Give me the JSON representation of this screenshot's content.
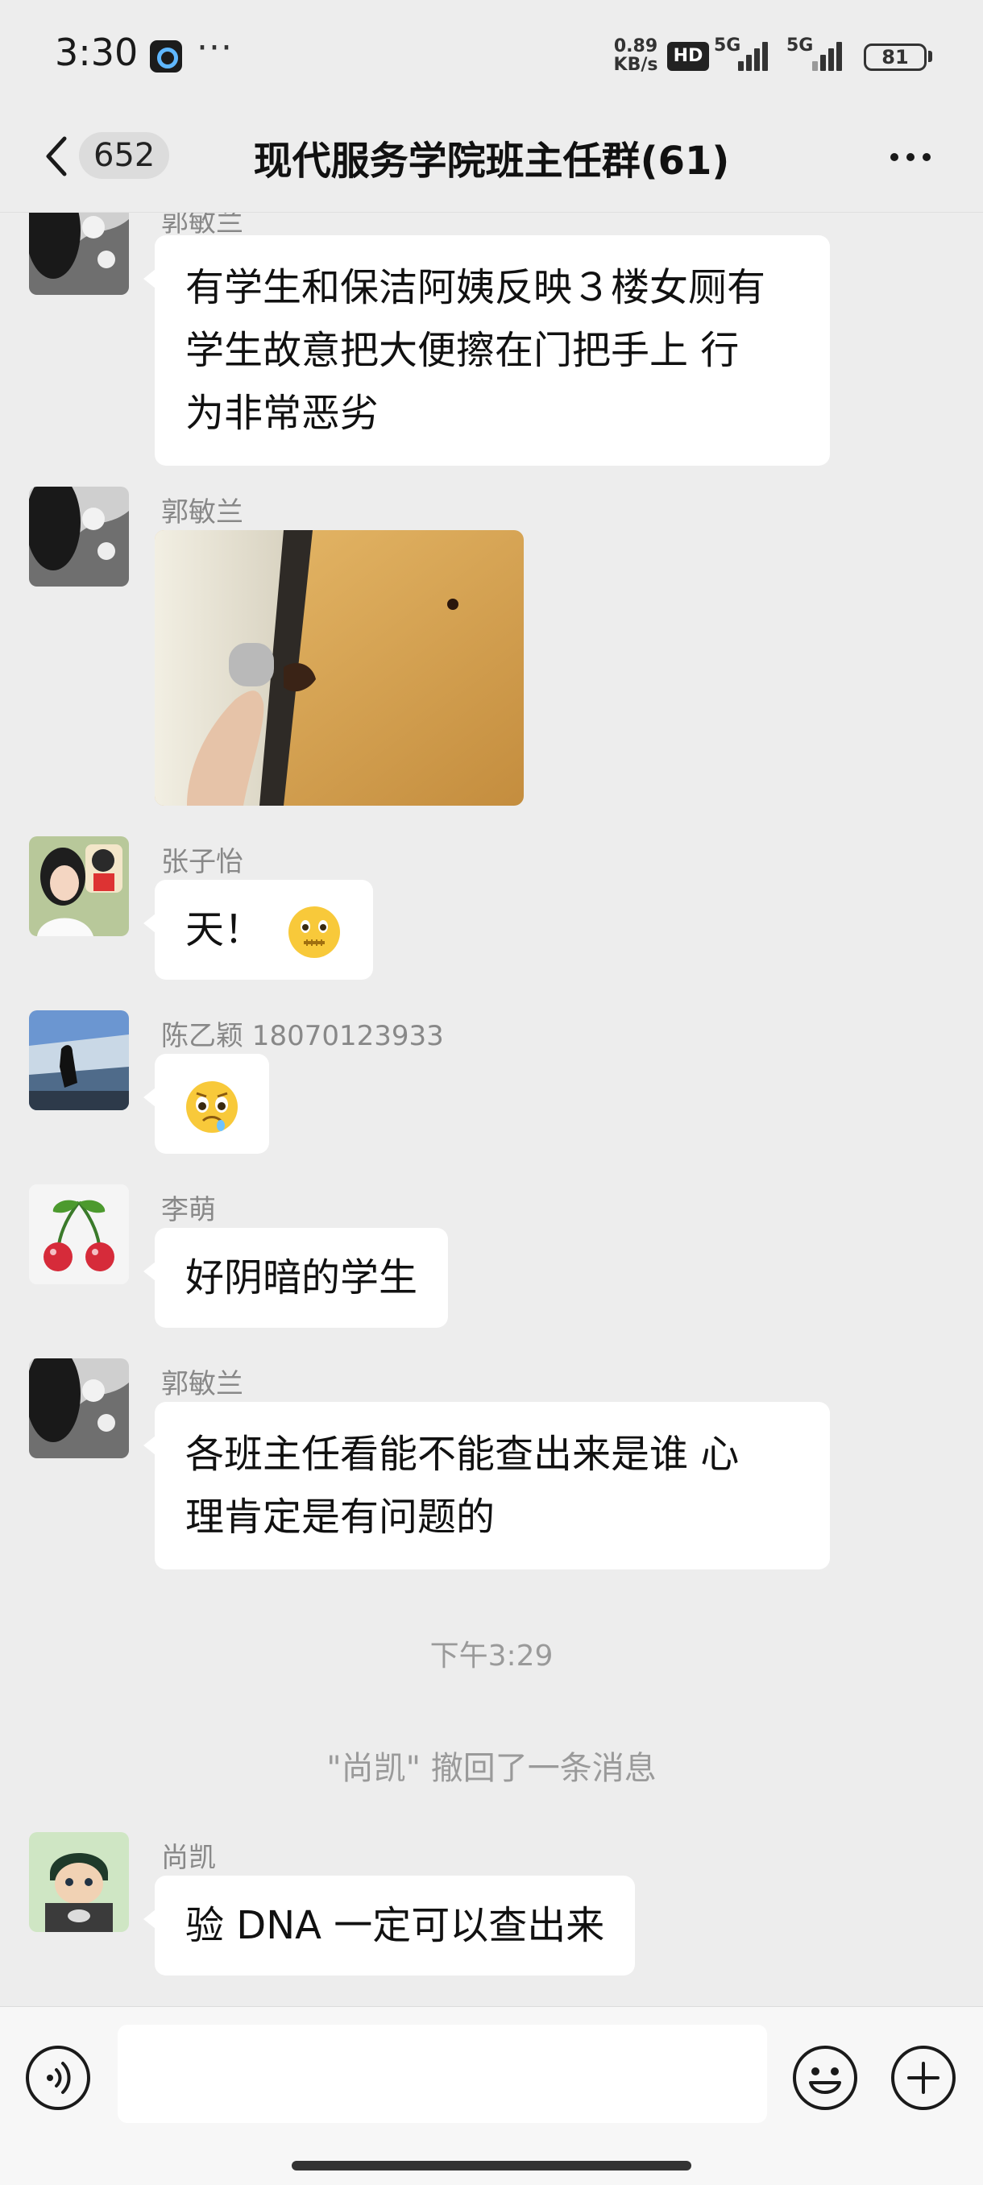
{
  "status_bar": {
    "time": "3:30",
    "overflow": "···",
    "net_speed": "0.89",
    "net_speed_unit": "KB/s",
    "hd": "HD",
    "network_1": "5G",
    "network_2": "5G",
    "battery": "81"
  },
  "header": {
    "unread_count": "652",
    "title": "现代服务学院班主任群(61)"
  },
  "messages": [
    {
      "sender": "郭敏兰",
      "lines": [
        "有学生和保洁阿姨反映３楼女厕有",
        "学生故意把大便擦在门把手上 行",
        "为非常恶劣"
      ],
      "avatar_icon": "profile-photo-dark-hair"
    },
    {
      "sender": "郭敏兰",
      "image": "door-handle-photo",
      "avatar_icon": "profile-photo-dark-hair"
    },
    {
      "sender": "张子怡",
      "text": "天！",
      "emoji": "zipper-mouth-face-emoji",
      "avatar_icon": "profile-photo-cartoon"
    },
    {
      "sender": "陈乙颖 18070123933",
      "emoji": "pleading-drooling-face-emoji",
      "avatar_icon": "profile-photo-glacier"
    },
    {
      "sender": "李萌",
      "text": "好阴暗的学生",
      "avatar_icon": "cherry-icon"
    },
    {
      "sender": "郭敏兰",
      "lines": [
        "各班主任看能不能查出来是谁 心",
        "理肯定是有问题的"
      ],
      "avatar_icon": "profile-photo-dark-hair"
    },
    {
      "sender": "尚凯",
      "text": "验 DNA 一定可以查出来",
      "avatar_icon": "profile-photo-anime"
    }
  ],
  "system": {
    "time": "下午3:29",
    "recall_notice": "\"尚凯\" 撤回了一条消息"
  },
  "input": {
    "value": "",
    "placeholder": ""
  },
  "icons": {
    "back": "chevron-left-icon",
    "more": "more-dots-icon",
    "voice": "voice-icon",
    "emoji": "emoji-icon",
    "plus": "plus-icon"
  },
  "colors": {
    "background": "#ededed",
    "bubble": "#ffffff",
    "meta_text": "#888888"
  }
}
